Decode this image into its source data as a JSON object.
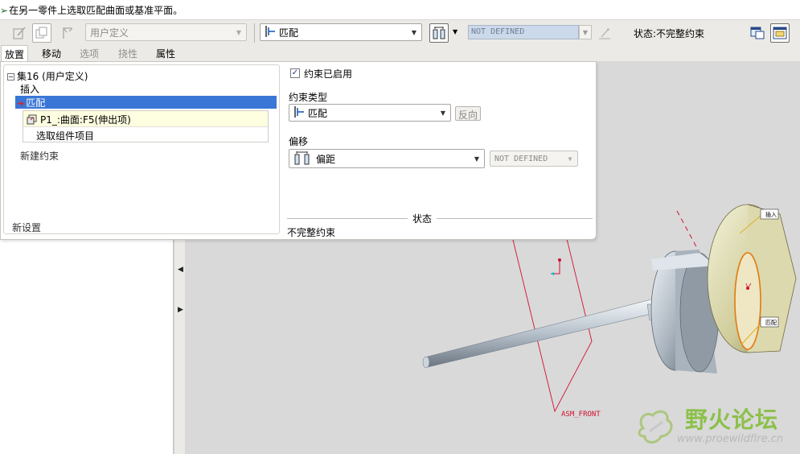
{
  "message": {
    "text": "在另一零件上选取匹配曲面或基准平面。"
  },
  "toolbar": {
    "type_combo": "用户定义",
    "constraint_combo": "匹配",
    "offset_value": "NOT DEFINED",
    "status_text": "状态:不完整约束"
  },
  "tabs": [
    {
      "label": "放置",
      "state": "active"
    },
    {
      "label": "移动",
      "state": "normal"
    },
    {
      "label": "选项",
      "state": "disabled"
    },
    {
      "label": "挠性",
      "state": "disabled"
    },
    {
      "label": "属性",
      "state": "normal"
    }
  ],
  "placement": {
    "set_label": "集16 (用户定义)",
    "insert_label": "插入",
    "selected_label": "匹配",
    "ref1": "P1_:曲面:F5(伸出项)",
    "ref2": "选取组件项目",
    "new_constraint": "新建约束",
    "new_set": "新设置",
    "enabled_label": "约束已启用",
    "enabled_checked": true,
    "type_caption": "约束类型",
    "type_value": "匹配",
    "flip_label": "反向",
    "offset_caption": "偏移",
    "offset_value": "偏距",
    "offset_num": "NOT DEFINED",
    "status_caption": "状态",
    "status_value": "不完整约束"
  },
  "viewport": {
    "datum_label": "ASM_FRONT",
    "tag_insert": "插入",
    "tag_match": "匹配"
  },
  "watermark": {
    "title": "野火论坛",
    "url": "www.proewildfire.cn"
  },
  "colors": {
    "selection": "#3976d6",
    "datum": "#d01030",
    "accent_green": "#8cc04a"
  }
}
